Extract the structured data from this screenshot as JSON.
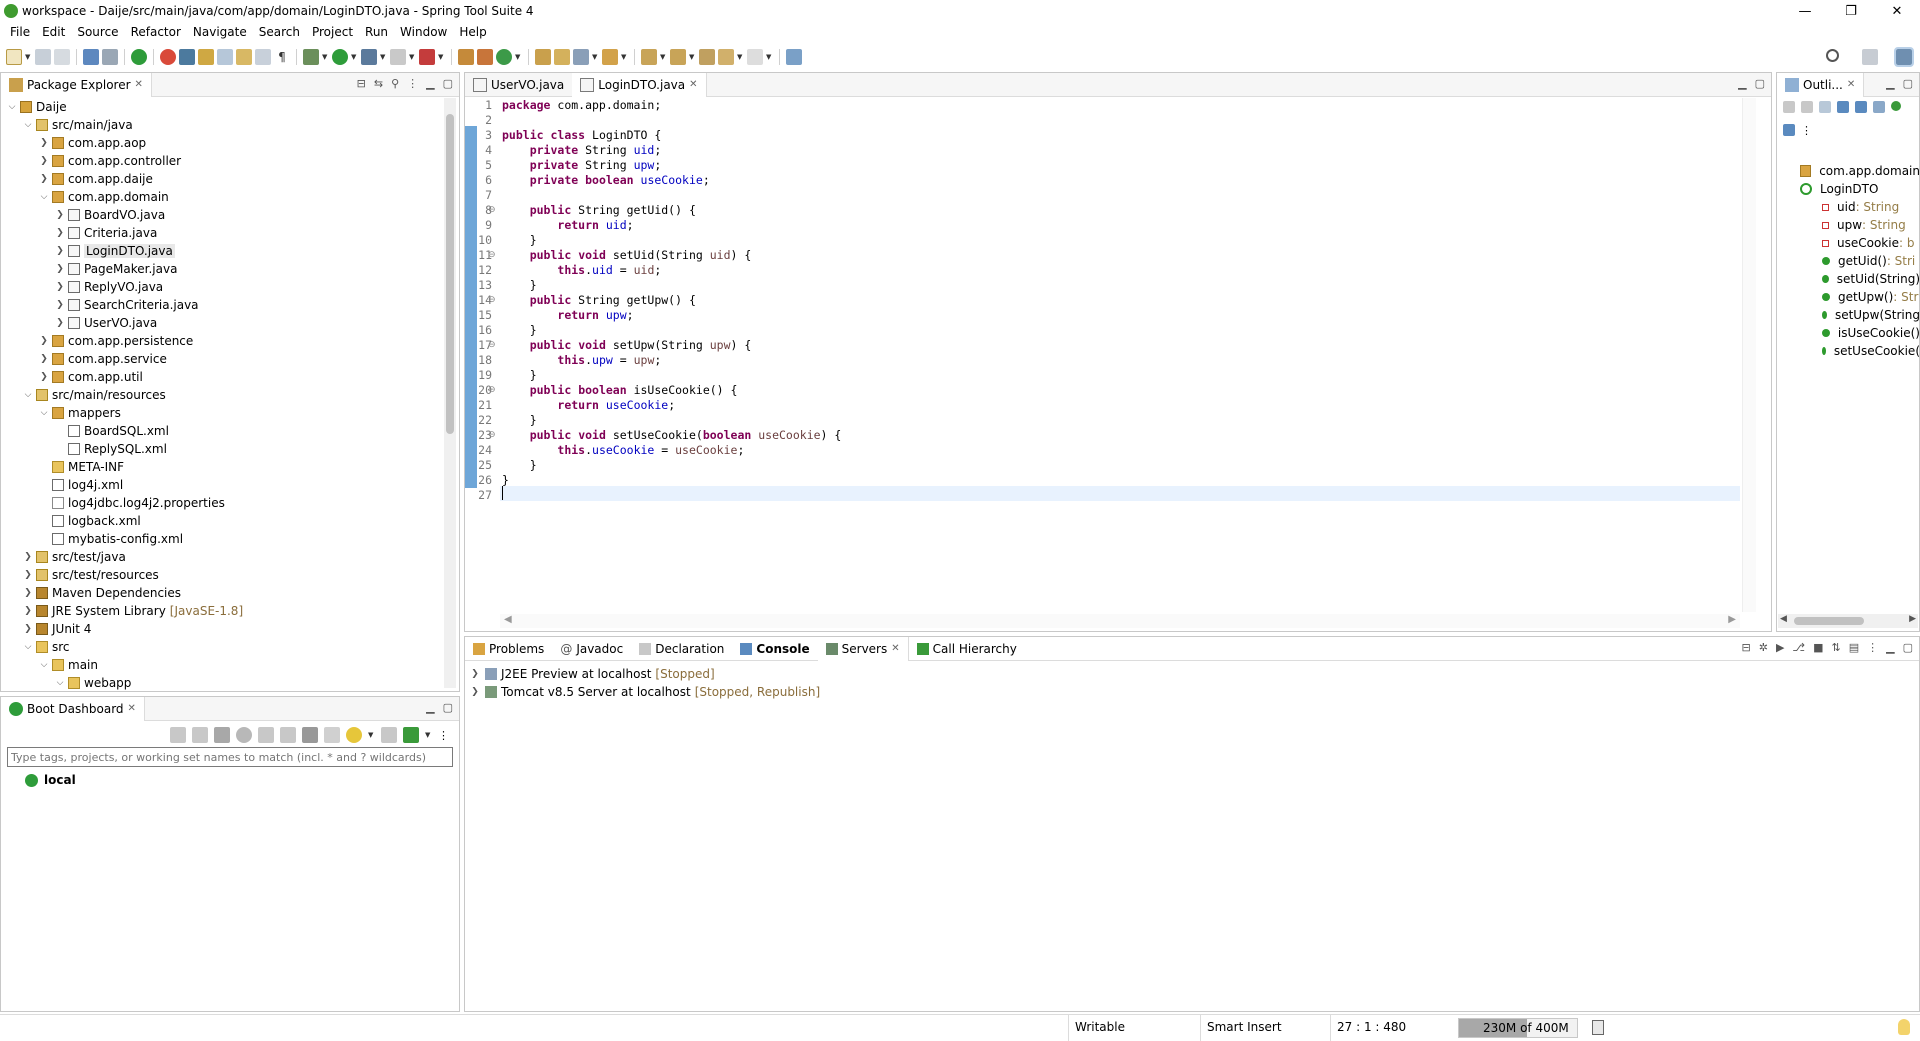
{
  "window": {
    "title": "workspace - Daije/src/main/java/com/app/domain/LoginDTO.java - Spring Tool Suite 4",
    "controls": [
      "—",
      "❐",
      "✕"
    ]
  },
  "menu": [
    "File",
    "Edit",
    "Source",
    "Refactor",
    "Navigate",
    "Search",
    "Project",
    "Run",
    "Window",
    "Help"
  ],
  "package_explorer": {
    "tab": "Package Explorer",
    "tree": [
      {
        "label": "Daije",
        "depth": 0,
        "exp": "open",
        "icon": "project"
      },
      {
        "label": "src/main/java",
        "depth": 1,
        "exp": "open",
        "icon": "srcfolder"
      },
      {
        "label": "com.app.aop",
        "depth": 2,
        "exp": "closed",
        "icon": "package"
      },
      {
        "label": "com.app.controller",
        "depth": 2,
        "exp": "closed",
        "icon": "package"
      },
      {
        "label": "com.app.daije",
        "depth": 2,
        "exp": "closed",
        "icon": "package"
      },
      {
        "label": "com.app.domain",
        "depth": 2,
        "exp": "open",
        "icon": "package"
      },
      {
        "label": "BoardVO.java",
        "depth": 3,
        "exp": "closed",
        "icon": "java"
      },
      {
        "label": "Criteria.java",
        "depth": 3,
        "exp": "closed",
        "icon": "java"
      },
      {
        "label": "LoginDTO.java",
        "depth": 3,
        "exp": "closed",
        "icon": "java",
        "selected": true
      },
      {
        "label": "PageMaker.java",
        "depth": 3,
        "exp": "closed",
        "icon": "java"
      },
      {
        "label": "ReplyVO.java",
        "depth": 3,
        "exp": "closed",
        "icon": "java"
      },
      {
        "label": "SearchCriteria.java",
        "depth": 3,
        "exp": "closed",
        "icon": "java"
      },
      {
        "label": "UserVO.java",
        "depth": 3,
        "exp": "closed",
        "icon": "java"
      },
      {
        "label": "com.app.persistence",
        "depth": 2,
        "exp": "closed",
        "icon": "package"
      },
      {
        "label": "com.app.service",
        "depth": 2,
        "exp": "closed",
        "icon": "package"
      },
      {
        "label": "com.app.util",
        "depth": 2,
        "exp": "closed",
        "icon": "package"
      },
      {
        "label": "src/main/resources",
        "depth": 1,
        "exp": "open",
        "icon": "srcfolder"
      },
      {
        "label": "mappers",
        "depth": 2,
        "exp": "open",
        "icon": "package"
      },
      {
        "label": "BoardSQL.xml",
        "depth": 3,
        "exp": "none",
        "icon": "xml"
      },
      {
        "label": "ReplySQL.xml",
        "depth": 3,
        "exp": "none",
        "icon": "xml"
      },
      {
        "label": "META-INF",
        "depth": 2,
        "exp": "none",
        "icon": "folder"
      },
      {
        "label": "log4j.xml",
        "depth": 2,
        "exp": "none",
        "icon": "xml"
      },
      {
        "label": "log4jdbc.log4j2.properties",
        "depth": 2,
        "exp": "none",
        "icon": "file"
      },
      {
        "label": "logback.xml",
        "depth": 2,
        "exp": "none",
        "icon": "xml"
      },
      {
        "label": "mybatis-config.xml",
        "depth": 2,
        "exp": "none",
        "icon": "xml"
      },
      {
        "label": "src/test/java",
        "depth": 1,
        "exp": "closed",
        "icon": "srcfolder"
      },
      {
        "label": "src/test/resources",
        "depth": 1,
        "exp": "closed",
        "icon": "srcfolder"
      },
      {
        "label": "Maven Dependencies",
        "depth": 1,
        "exp": "closed",
        "icon": "lib"
      },
      {
        "label": "JRE System Library",
        "depth": 1,
        "exp": "closed",
        "icon": "lib",
        "deco": "[JavaSE-1.8]"
      },
      {
        "label": "JUnit 4",
        "depth": 1,
        "exp": "closed",
        "icon": "lib"
      },
      {
        "label": "src",
        "depth": 1,
        "exp": "open",
        "icon": "folder"
      },
      {
        "label": "main",
        "depth": 2,
        "exp": "open",
        "icon": "folder"
      },
      {
        "label": "webapp",
        "depth": 3,
        "exp": "open",
        "icon": "folder"
      }
    ]
  },
  "boot_dashboard": {
    "tab": "Boot Dashboard",
    "filter_placeholder": "Type tags, projects, or working set names to match (incl. * and ? wildcards)",
    "items": [
      "local"
    ]
  },
  "editor": {
    "tabs": [
      {
        "label": "UserVO.java",
        "active": false
      },
      {
        "label": "LoginDTO.java",
        "active": true
      }
    ],
    "lines": [
      "package com.app.domain;",
      "",
      "public class LoginDTO {",
      "    private String uid;",
      "    private String upw;",
      "    private boolean useCookie;",
      "",
      "    public String getUid() {",
      "        return uid;",
      "    }",
      "    public void setUid(String uid) {",
      "        this.uid = uid;",
      "    }",
      "    public String getUpw() {",
      "        return upw;",
      "    }",
      "    public void setUpw(String upw) {",
      "        this.upw = upw;",
      "    }",
      "    public boolean isUseCookie() {",
      "        return useCookie;",
      "    }",
      "    public void setUseCookie(boolean useCookie) {",
      "        this.useCookie = useCookie;",
      "    }",
      "}",
      ""
    ],
    "fold_lines": [
      8,
      11,
      14,
      17,
      20,
      23
    ]
  },
  "outline": {
    "tab": "Outli...",
    "items": [
      {
        "label": "com.app.domain",
        "kind": "package",
        "depth": 0
      },
      {
        "label": "LoginDTO",
        "kind": "class",
        "depth": 0
      },
      {
        "label": "uid",
        "type": " : String",
        "kind": "field",
        "depth": 1
      },
      {
        "label": "upw",
        "type": " : String",
        "kind": "field",
        "depth": 1
      },
      {
        "label": "useCookie",
        "type": " : b",
        "kind": "field",
        "depth": 1
      },
      {
        "label": "getUid()",
        "type": " : Stri",
        "kind": "method",
        "depth": 1
      },
      {
        "label": "setUid(String)",
        "type": "",
        "kind": "method",
        "depth": 1
      },
      {
        "label": "getUpw()",
        "type": " : Str",
        "kind": "method",
        "depth": 1
      },
      {
        "label": "setUpw(String",
        "type": "",
        "kind": "method",
        "depth": 1
      },
      {
        "label": "isUseCookie()",
        "type": "",
        "kind": "method",
        "depth": 1
      },
      {
        "label": "setUseCookie(",
        "type": "",
        "kind": "method",
        "depth": 1
      }
    ]
  },
  "bottom": {
    "tabs": [
      {
        "label": "Problems"
      },
      {
        "label": "Javadoc"
      },
      {
        "label": "Declaration"
      },
      {
        "label": "Console",
        "bold": true
      },
      {
        "label": "Servers",
        "closable": true
      },
      {
        "label": "Call Hierarchy"
      }
    ],
    "servers": [
      {
        "name": "J2EE Preview at localhost",
        "status": "[Stopped]"
      },
      {
        "name": "Tomcat v8.5 Server at localhost",
        "status": "[Stopped, Republish]"
      }
    ]
  },
  "status": {
    "writable": "Writable",
    "insert": "Smart Insert",
    "position": "27 : 1 : 480",
    "memory": "230M of 400M",
    "memory_used_fraction": 0.575
  }
}
